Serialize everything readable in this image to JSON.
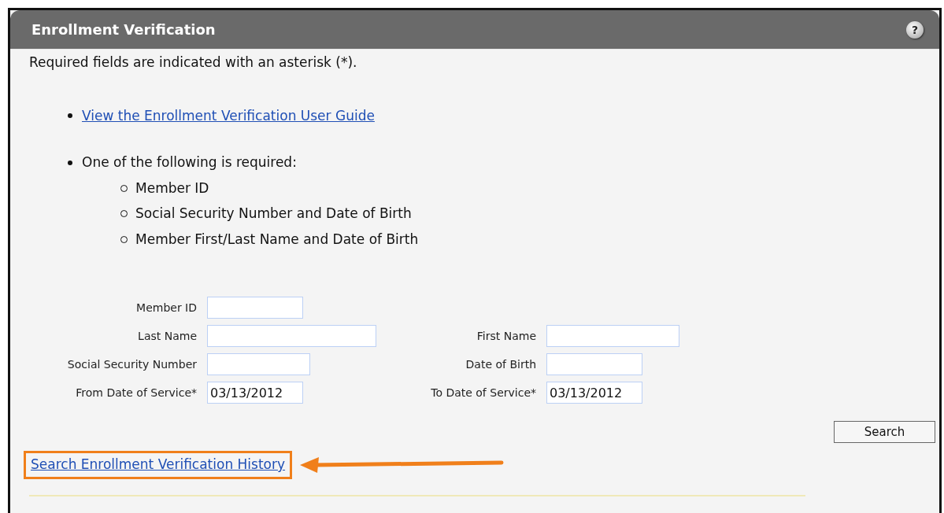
{
  "panel": {
    "title": "Enrollment Verification",
    "help_button": "?"
  },
  "intro": "Required fields are indicated with an asterisk (*).",
  "bullets": [
    {
      "kind": "link",
      "text": "View the Enrollment Verification User Guide"
    },
    {
      "kind": "text",
      "text": "One of the following is required:",
      "children": [
        {
          "text": "Member ID"
        },
        {
          "text": "Social Security Number and Date of Birth"
        },
        {
          "text": "Member First/Last Name and Date of Birth"
        }
      ]
    }
  ],
  "form_rows": [
    {
      "fields": [
        {
          "label": "Member ID"
        }
      ]
    },
    {
      "fields": [
        {
          "label": "Last Name"
        },
        {
          "label": "First Name"
        }
      ]
    },
    {
      "fields": [
        {
          "label": "Social Security Number"
        },
        {
          "label": "Date of Birth"
        }
      ]
    },
    {
      "fields": [
        {
          "label": "From Date of Service*",
          "value": "03/13/2012"
        },
        {
          "label": "To Date of Service*",
          "value": "03/13/2012"
        }
      ]
    }
  ],
  "search_button": "Search",
  "history_link": {
    "text": "Search Enrollment Verification History",
    "highlighted": true
  }
}
